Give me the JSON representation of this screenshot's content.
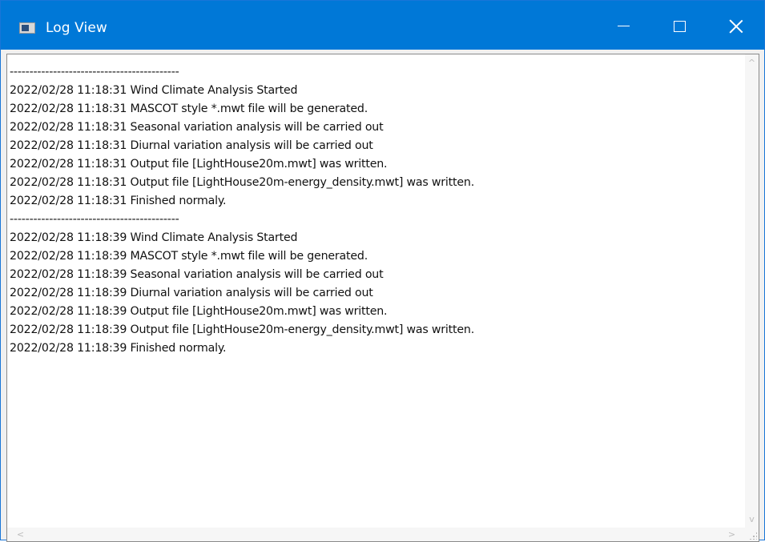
{
  "window": {
    "title": "Log View",
    "icon": "app-window-icon",
    "titlebar_color": "#0078d7",
    "controls": {
      "minimize_icon": "minimize-icon",
      "maximize_icon": "maximize-icon",
      "close_icon": "close-icon"
    }
  },
  "log": {
    "lines": [
      "-------------------------------------------",
      "2022/02/28 11:18:31 Wind Climate Analysis Started",
      "2022/02/28 11:18:31 MASCOT style *.mwt file will be generated.",
      "2022/02/28 11:18:31 Seasonal variation analysis will be carried out",
      "2022/02/28 11:18:31 Diurnal variation analysis will be carried out",
      "2022/02/28 11:18:31 Output file [LightHouse20m.mwt] was written.",
      "2022/02/28 11:18:31 Output file [LightHouse20m-energy_density.mwt] was written.",
      "2022/02/28 11:18:31 Finished normaly.",
      "-------------------------------------------",
      "2022/02/28 11:18:39 Wind Climate Analysis Started",
      "2022/02/28 11:18:39 MASCOT style *.mwt file will be generated.",
      "2022/02/28 11:18:39 Seasonal variation analysis will be carried out",
      "2022/02/28 11:18:39 Diurnal variation analysis will be carried out",
      "2022/02/28 11:18:39 Output file [LightHouse20m.mwt] was written.",
      "2022/02/28 11:18:39 Output file [LightHouse20m-energy_density.mwt] was written.",
      "2022/02/28 11:18:39 Finished normaly."
    ]
  },
  "scrollbars": {
    "up_glyph": "^",
    "down_glyph": "v",
    "left_glyph": "<",
    "right_glyph": ">"
  }
}
